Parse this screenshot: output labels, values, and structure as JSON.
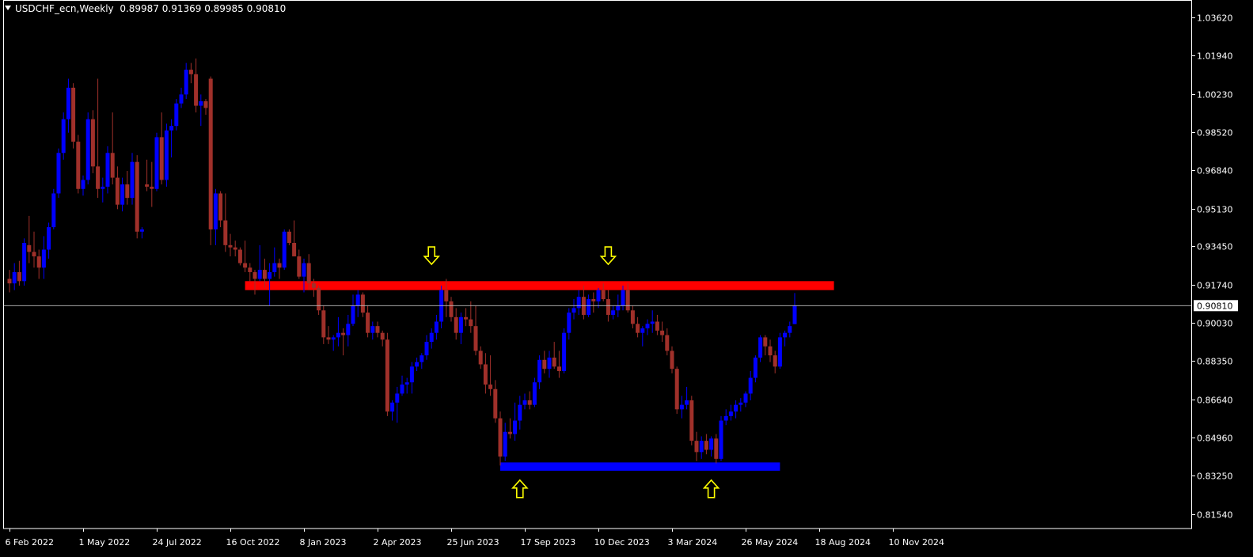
{
  "header": {
    "symbol_timeframe": "USDCHF_ecn,Weekly",
    "ohlc": "0.89987 0.91369 0.89985 0.90810"
  },
  "colors": {
    "background": "#000000",
    "bull": "#0000ff",
    "bear": "#a0302a",
    "resistance_zone": "#ff0000",
    "support_zone": "#0000ff",
    "arrow": "#ffff00",
    "axis": "#ffffff",
    "current_price_line": "#c0c0c0"
  },
  "chart_data": {
    "type": "candlestick",
    "title": "",
    "xlabel": "",
    "ylabel": "",
    "ylim": [
      0.809,
      1.044
    ],
    "yticks": [
      "1.03620",
      "1.01940",
      "1.00230",
      "0.98520",
      "0.96840",
      "0.95130",
      "0.93450",
      "0.91740",
      "0.90030",
      "0.88350",
      "0.86640",
      "0.84960",
      "0.83250",
      "0.81540"
    ],
    "xticks": [
      "6 Feb 2022",
      "1 May 2022",
      "24 Jul 2022",
      "16 Oct 2022",
      "8 Jan 2023",
      "2 Apr 2023",
      "25 Jun 2023",
      "17 Sep 2023",
      "10 Dec 2023",
      "3 Mar 2024",
      "26 May 2024",
      "18 Aug 2024",
      "10 Nov 2024"
    ],
    "current_price": 0.9081,
    "current_price_label": "0.90810",
    "zones": [
      {
        "role": "resistance",
        "y_low": 0.915,
        "y_high": 0.919,
        "from_week": 48,
        "to_week": 168
      },
      {
        "role": "support",
        "y_low": 0.8347,
        "y_high": 0.8384,
        "from_week": 100,
        "to_week": 157
      }
    ],
    "arrows": [
      {
        "direction": "down",
        "week": 86,
        "price": 0.93
      },
      {
        "direction": "down",
        "week": 122,
        "price": 0.93
      },
      {
        "direction": "up",
        "week": 104,
        "price": 0.827
      },
      {
        "direction": "up",
        "week": 143,
        "price": 0.827
      }
    ],
    "candles": [
      [
        0.92,
        0.924,
        0.914,
        0.918
      ],
      [
        0.918,
        0.927,
        0.915,
        0.923
      ],
      [
        0.923,
        0.928,
        0.917,
        0.919
      ],
      [
        0.919,
        0.938,
        0.917,
        0.936
      ],
      [
        0.935,
        0.948,
        0.927,
        0.932
      ],
      [
        0.932,
        0.941,
        0.925,
        0.93
      ],
      [
        0.93,
        0.933,
        0.92,
        0.925
      ],
      [
        0.925,
        0.939,
        0.92,
        0.933
      ],
      [
        0.933,
        0.945,
        0.929,
        0.943
      ],
      [
        0.943,
        0.96,
        0.942,
        0.958
      ],
      [
        0.958,
        0.978,
        0.956,
        0.976
      ],
      [
        0.976,
        0.994,
        0.973,
        0.991
      ],
      [
        0.991,
        1.009,
        0.985,
        1.005
      ],
      [
        1.005,
        1.007,
        0.978,
        0.981
      ],
      [
        0.981,
        0.984,
        0.958,
        0.96
      ],
      [
        0.96,
        0.966,
        0.957,
        0.964
      ],
      [
        0.964,
        0.994,
        0.962,
        0.991
      ],
      [
        0.991,
        0.995,
        0.967,
        0.97
      ],
      [
        0.97,
        1.009,
        0.956,
        0.96
      ],
      [
        0.96,
        0.965,
        0.954,
        0.961
      ],
      [
        0.961,
        0.979,
        0.958,
        0.976
      ],
      [
        0.976,
        0.994,
        0.962,
        0.965
      ],
      [
        0.965,
        0.97,
        0.951,
        0.953
      ],
      [
        0.953,
        0.965,
        0.95,
        0.962
      ],
      [
        0.962,
        0.968,
        0.953,
        0.956
      ],
      [
        0.956,
        0.976,
        0.953,
        0.972
      ],
      [
        0.972,
        0.975,
        0.938,
        0.941
      ],
      [
        0.941,
        0.943,
        0.938,
        0.942
      ],
      [
        0.962,
        0.973,
        0.959,
        0.961
      ],
      [
        0.961,
        0.972,
        0.952,
        0.96
      ],
      [
        0.96,
        0.985,
        0.959,
        0.983
      ],
      [
        0.983,
        0.994,
        0.962,
        0.964
      ],
      [
        0.964,
        0.989,
        0.961,
        0.986
      ],
      [
        0.986,
        0.991,
        0.974,
        0.988
      ],
      [
        0.988,
        1.0,
        0.986,
        0.998
      ],
      [
        0.998,
        1.005,
        0.996,
        1.002
      ],
      [
        1.002,
        1.016,
        1.0,
        1.013
      ],
      [
        1.013,
        1.016,
        1.007,
        1.011
      ],
      [
        1.011,
        1.018,
        0.994,
        0.997
      ],
      [
        0.997,
        1.002,
        0.988,
        0.999
      ],
      [
        0.999,
        1.0,
        0.993,
        0.996
      ],
      [
        1.009,
        1.01,
        0.935,
        0.942
      ],
      [
        0.942,
        0.96,
        0.935,
        0.958
      ],
      [
        0.958,
        0.959,
        0.943,
        0.946
      ],
      [
        0.946,
        0.958,
        0.932,
        0.935
      ],
      [
        0.935,
        0.94,
        0.93,
        0.934
      ],
      [
        0.934,
        0.937,
        0.93,
        0.933
      ],
      [
        0.933,
        0.934,
        0.926,
        0.927
      ],
      [
        0.927,
        0.937,
        0.923,
        0.925
      ],
      [
        0.925,
        0.927,
        0.919,
        0.923
      ],
      [
        0.923,
        0.924,
        0.913,
        0.92
      ],
      [
        0.92,
        0.935,
        0.919,
        0.924
      ],
      [
        0.924,
        0.929,
        0.916,
        0.92
      ],
      [
        0.92,
        0.927,
        0.908,
        0.923
      ],
      [
        0.923,
        0.934,
        0.921,
        0.927
      ],
      [
        0.927,
        0.929,
        0.92,
        0.925
      ],
      [
        0.925,
        0.942,
        0.924,
        0.941
      ],
      [
        0.941,
        0.942,
        0.935,
        0.936
      ],
      [
        0.936,
        0.946,
        0.93,
        0.93
      ],
      [
        0.93,
        0.933,
        0.92,
        0.921
      ],
      [
        0.921,
        0.929,
        0.914,
        0.927
      ],
      [
        0.927,
        0.931,
        0.915,
        0.918
      ],
      [
        0.918,
        0.92,
        0.912,
        0.916
      ],
      [
        0.916,
        0.917,
        0.904,
        0.906
      ],
      [
        0.906,
        0.908,
        0.891,
        0.894
      ],
      [
        0.894,
        0.899,
        0.891,
        0.893
      ],
      [
        0.893,
        0.895,
        0.888,
        0.894
      ],
      [
        0.894,
        0.903,
        0.89,
        0.896
      ],
      [
        0.896,
        0.898,
        0.886,
        0.895
      ],
      [
        0.895,
        0.904,
        0.89,
        0.9
      ],
      [
        0.9,
        0.913,
        0.899,
        0.908
      ],
      [
        0.908,
        0.915,
        0.903,
        0.913
      ],
      [
        0.913,
        0.914,
        0.903,
        0.905
      ],
      [
        0.905,
        0.908,
        0.894,
        0.896
      ],
      [
        0.896,
        0.901,
        0.893,
        0.899
      ],
      [
        0.899,
        0.901,
        0.894,
        0.896
      ],
      [
        0.896,
        0.897,
        0.89,
        0.893
      ],
      [
        0.893,
        0.896,
        0.859,
        0.861
      ],
      [
        0.861,
        0.866,
        0.857,
        0.865
      ],
      [
        0.865,
        0.872,
        0.856,
        0.869
      ],
      [
        0.869,
        0.877,
        0.868,
        0.873
      ],
      [
        0.873,
        0.876,
        0.869,
        0.874
      ],
      [
        0.874,
        0.883,
        0.869,
        0.881
      ],
      [
        0.881,
        0.885,
        0.879,
        0.883
      ],
      [
        0.883,
        0.887,
        0.88,
        0.886
      ],
      [
        0.886,
        0.895,
        0.884,
        0.892
      ],
      [
        0.892,
        0.898,
        0.889,
        0.896
      ],
      [
        0.896,
        0.904,
        0.893,
        0.901
      ],
      [
        0.901,
        0.917,
        0.898,
        0.915
      ],
      [
        0.915,
        0.92,
        0.903,
        0.91
      ],
      [
        0.91,
        0.912,
        0.901,
        0.903
      ],
      [
        0.903,
        0.907,
        0.893,
        0.896
      ],
      [
        0.896,
        0.905,
        0.891,
        0.903
      ],
      [
        0.903,
        0.907,
        0.899,
        0.902
      ],
      [
        0.902,
        0.91,
        0.896,
        0.899
      ],
      [
        0.899,
        0.908,
        0.886,
        0.888
      ],
      [
        0.888,
        0.89,
        0.88,
        0.882
      ],
      [
        0.882,
        0.887,
        0.869,
        0.873
      ],
      [
        0.873,
        0.886,
        0.868,
        0.871
      ],
      [
        0.871,
        0.875,
        0.856,
        0.858
      ],
      [
        0.858,
        0.861,
        0.837,
        0.841
      ],
      [
        0.841,
        0.856,
        0.839,
        0.852
      ],
      [
        0.852,
        0.858,
        0.849,
        0.851
      ],
      [
        0.851,
        0.865,
        0.848,
        0.857
      ],
      [
        0.857,
        0.868,
        0.853,
        0.864
      ],
      [
        0.864,
        0.869,
        0.862,
        0.866
      ],
      [
        0.866,
        0.87,
        0.862,
        0.864
      ],
      [
        0.864,
        0.876,
        0.863,
        0.874
      ],
      [
        0.874,
        0.886,
        0.871,
        0.884
      ],
      [
        0.884,
        0.888,
        0.878,
        0.88
      ],
      [
        0.88,
        0.888,
        0.876,
        0.885
      ],
      [
        0.885,
        0.892,
        0.88,
        0.881
      ],
      [
        0.881,
        0.888,
        0.876,
        0.879
      ],
      [
        0.879,
        0.898,
        0.878,
        0.896
      ],
      [
        0.896,
        0.907,
        0.893,
        0.905
      ],
      [
        0.905,
        0.911,
        0.902,
        0.907
      ],
      [
        0.907,
        0.915,
        0.904,
        0.912
      ],
      [
        0.912,
        0.917,
        0.902,
        0.904
      ],
      [
        0.904,
        0.913,
        0.903,
        0.911
      ],
      [
        0.911,
        0.914,
        0.905,
        0.91
      ],
      [
        0.91,
        0.916,
        0.907,
        0.915
      ],
      [
        0.915,
        0.918,
        0.91,
        0.911
      ],
      [
        0.911,
        0.915,
        0.901,
        0.904
      ],
      [
        0.904,
        0.908,
        0.902,
        0.906
      ],
      [
        0.906,
        0.913,
        0.903,
        0.908
      ],
      [
        0.908,
        0.917,
        0.906,
        0.915
      ],
      [
        0.915,
        0.918,
        0.905,
        0.906
      ],
      [
        0.906,
        0.908,
        0.898,
        0.9
      ],
      [
        0.9,
        0.903,
        0.894,
        0.896
      ],
      [
        0.896,
        0.899,
        0.89,
        0.898
      ],
      [
        0.898,
        0.902,
        0.895,
        0.9
      ],
      [
        0.9,
        0.906,
        0.896,
        0.901
      ],
      [
        0.901,
        0.904,
        0.895,
        0.897
      ],
      [
        0.897,
        0.901,
        0.892,
        0.895
      ],
      [
        0.895,
        0.898,
        0.886,
        0.888
      ],
      [
        0.888,
        0.89,
        0.878,
        0.88
      ],
      [
        0.88,
        0.881,
        0.86,
        0.862
      ],
      [
        0.862,
        0.868,
        0.858,
        0.864
      ],
      [
        0.864,
        0.872,
        0.862,
        0.866
      ],
      [
        0.866,
        0.868,
        0.846,
        0.848
      ],
      [
        0.848,
        0.852,
        0.839,
        0.843
      ],
      [
        0.843,
        0.85,
        0.84,
        0.848
      ],
      [
        0.848,
        0.851,
        0.842,
        0.844
      ],
      [
        0.844,
        0.85,
        0.841,
        0.849
      ],
      [
        0.849,
        0.851,
        0.838,
        0.84
      ],
      [
        0.84,
        0.859,
        0.839,
        0.857
      ],
      [
        0.857,
        0.862,
        0.855,
        0.859
      ],
      [
        0.859,
        0.864,
        0.857,
        0.861
      ],
      [
        0.861,
        0.866,
        0.858,
        0.864
      ],
      [
        0.864,
        0.867,
        0.861,
        0.865
      ],
      [
        0.865,
        0.87,
        0.863,
        0.869
      ],
      [
        0.869,
        0.879,
        0.866,
        0.876
      ],
      [
        0.876,
        0.886,
        0.874,
        0.885
      ],
      [
        0.885,
        0.895,
        0.883,
        0.894
      ],
      [
        0.894,
        0.895,
        0.886,
        0.89
      ],
      [
        0.89,
        0.893,
        0.883,
        0.886
      ],
      [
        0.886,
        0.888,
        0.878,
        0.881
      ],
      [
        0.881,
        0.896,
        0.88,
        0.894
      ],
      [
        0.894,
        0.897,
        0.89,
        0.896
      ],
      [
        0.896,
        0.901,
        0.894,
        0.899
      ],
      [
        0.8999,
        0.9137,
        0.8999,
        0.9081
      ]
    ]
  }
}
